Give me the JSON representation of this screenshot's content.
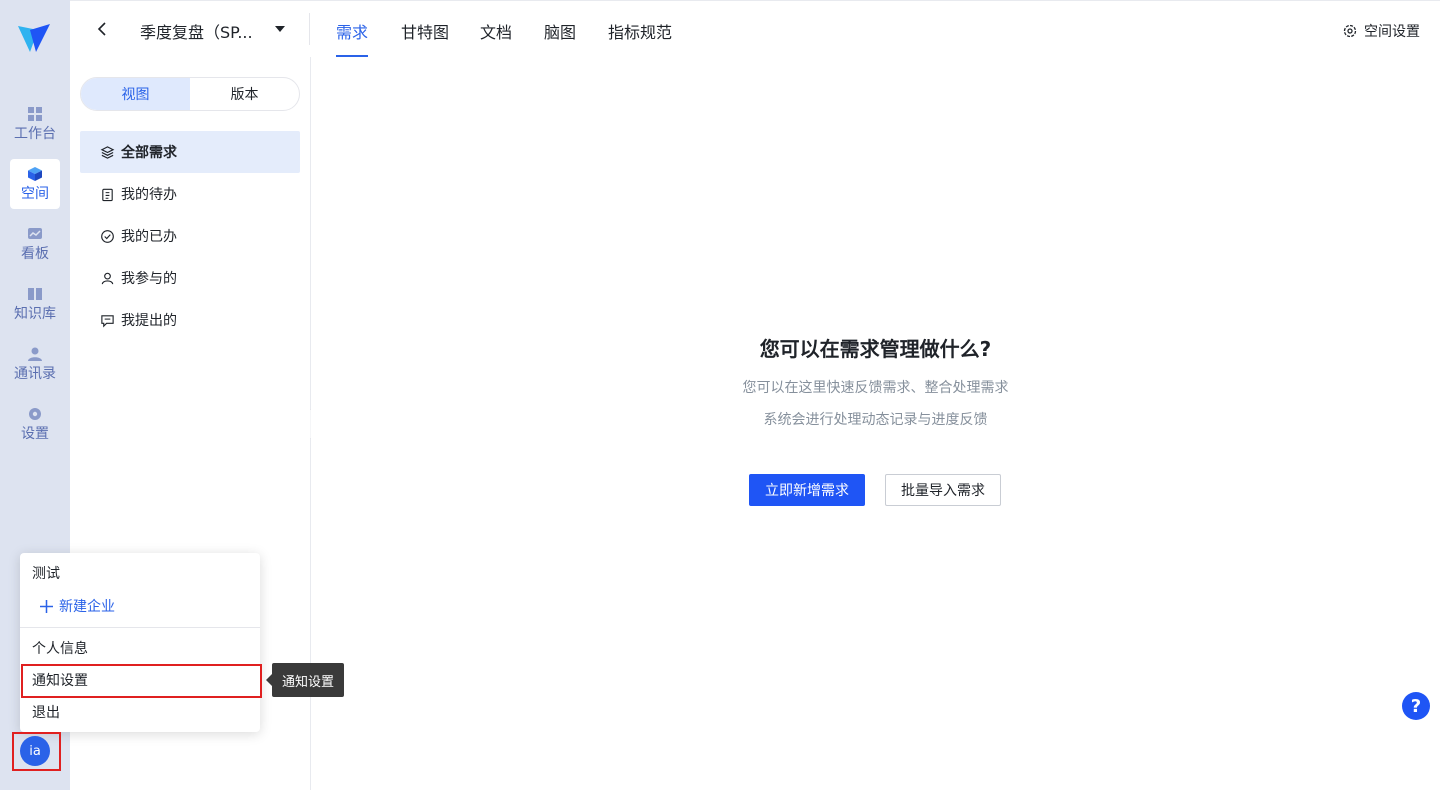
{
  "rail": {
    "items": [
      {
        "label": "工作台",
        "icon": "dashboard-icon"
      },
      {
        "label": "空间",
        "icon": "cube-icon"
      },
      {
        "label": "看板",
        "icon": "chart-board-icon"
      },
      {
        "label": "知识库",
        "icon": "book-icon"
      },
      {
        "label": "通讯录",
        "icon": "person-icon"
      },
      {
        "label": "设置",
        "icon": "gear-icon"
      }
    ],
    "active": "空间",
    "avatar_text": "ia"
  },
  "header": {
    "space_name": "季度复盘（SP...",
    "tabs": [
      "需求",
      "甘特图",
      "文档",
      "脑图",
      "指标规范"
    ],
    "active_tab": "需求",
    "settings_label": "空间设置"
  },
  "sidebar": {
    "segments": [
      "视图",
      "版本"
    ],
    "active_segment": "视图",
    "items": [
      {
        "label": "全部需求",
        "icon": "layers-icon"
      },
      {
        "label": "我的待办",
        "icon": "clipboard-icon"
      },
      {
        "label": "我的已办",
        "icon": "check-circle-icon"
      },
      {
        "label": "我参与的",
        "icon": "user-icon"
      },
      {
        "label": "我提出的",
        "icon": "message-icon"
      }
    ]
  },
  "main": {
    "empty_title": "您可以在需求管理做什么?",
    "empty_desc_1": "您可以在这里快速反馈需求、整合处理需求",
    "empty_desc_2": "系统会进行处理动态记录与进度反馈",
    "primary_button": "立即新增需求",
    "secondary_button": "批量导入需求"
  },
  "popover": {
    "org_name": "测试",
    "new_org": "新建企业",
    "items": [
      "个人信息",
      "通知设置",
      "退出"
    ],
    "tooltip": "通知设置"
  },
  "help_label": "?",
  "colors": {
    "accent": "#2a62e8",
    "primary_button": "#1f55f5",
    "rail_bg": "#dde3f0",
    "highlight_box": "#e02020"
  }
}
